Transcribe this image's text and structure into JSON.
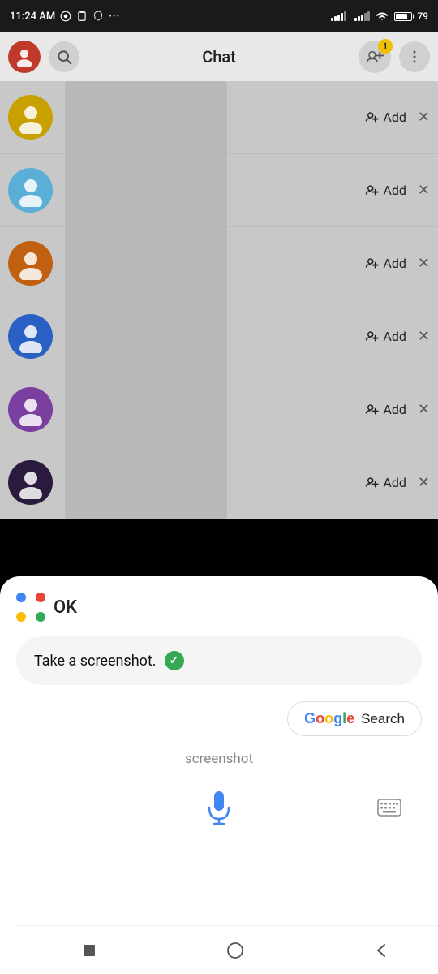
{
  "statusBar": {
    "time": "11:24 AM",
    "battery": 79,
    "batteryFill": "75%"
  },
  "header": {
    "title": "Chat",
    "notificationCount": "1",
    "searchLabel": "search",
    "addFriendLabel": "add friend",
    "moreLabel": "more options"
  },
  "chatRows": [
    {
      "color": "#c8a000",
      "id": 1
    },
    {
      "color": "#5bafd6",
      "id": 2
    },
    {
      "color": "#c06010",
      "id": 3
    },
    {
      "color": "#2a5fc4",
      "id": 4
    },
    {
      "color": "#7b3fa0",
      "id": 5
    },
    {
      "color": "#2a1a3e",
      "id": 6
    }
  ],
  "addLabel": "Add",
  "assistant": {
    "ok": "OK",
    "command": "Take a screenshot.",
    "searchLabel": "Search",
    "transcript": "screenshot",
    "gLogo": "G"
  },
  "nav": {
    "stopLabel": "stop",
    "homeLabel": "home",
    "backLabel": "back"
  }
}
